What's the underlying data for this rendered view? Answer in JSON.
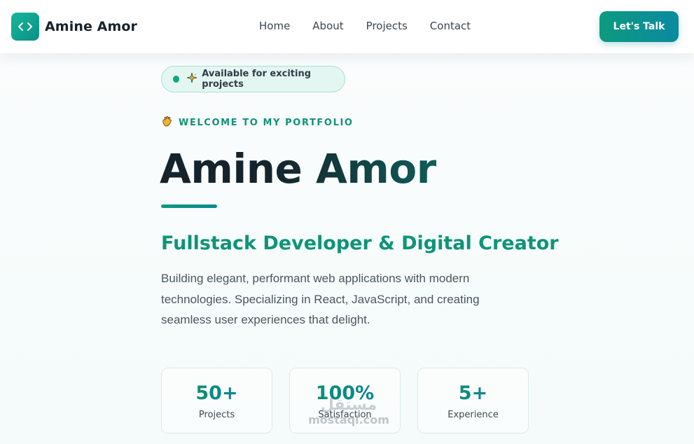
{
  "brand": {
    "name": "Amine Amor",
    "logo_icon": "code-brackets-icon"
  },
  "nav": {
    "links": [
      {
        "label": "Home"
      },
      {
        "label": "About"
      },
      {
        "label": "Projects"
      },
      {
        "label": "Contact"
      }
    ],
    "cta_label": "Let's Talk"
  },
  "hero": {
    "availability": {
      "text": "Available for exciting projects",
      "icon": "sparkle-icon"
    },
    "welcome": {
      "text": "WELCOME TO MY PORTFOLIO",
      "icon": "wave-icon"
    },
    "name": "Amine Amor",
    "subtitle": "Fullstack Developer & Digital Creator",
    "description": "Building elegant, performant web applications with modern technologies. Specializing in React, JavaScript, and creating seamless user experiences that delight."
  },
  "stats": [
    {
      "value": "50+",
      "label": "Projects"
    },
    {
      "value": "100%",
      "label": "Satisfaction"
    },
    {
      "value": "5+",
      "label": "Experience"
    }
  ],
  "watermark": {
    "arabic": "مستقل",
    "latin": "mostaql.com"
  },
  "colors": {
    "accent": "#0e9478",
    "accent_dark": "#0b8aa1",
    "text_dark": "#15232c"
  }
}
